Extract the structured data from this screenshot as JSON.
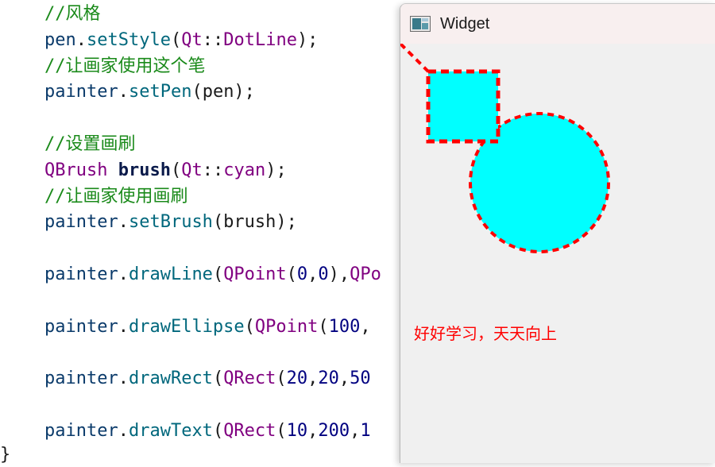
{
  "editor": {
    "lines": [
      {
        "segments": [
          {
            "t": "//风格",
            "c": "c-comment"
          }
        ]
      },
      {
        "segments": [
          {
            "t": "pen",
            "c": "c-obj"
          },
          {
            "t": ".",
            "c": "c-punct"
          },
          {
            "t": "setStyle",
            "c": "c-method"
          },
          {
            "t": "(",
            "c": "c-punct"
          },
          {
            "t": "Qt",
            "c": "c-type"
          },
          {
            "t": "::",
            "c": "c-punct"
          },
          {
            "t": "DotLine",
            "c": "c-type"
          },
          {
            "t": ");",
            "c": "c-punct"
          }
        ]
      },
      {
        "segments": [
          {
            "t": "//让画家使用这个笔",
            "c": "c-comment"
          }
        ]
      },
      {
        "segments": [
          {
            "t": "painter",
            "c": "c-obj"
          },
          {
            "t": ".",
            "c": "c-punct"
          },
          {
            "t": "setPen",
            "c": "c-method"
          },
          {
            "t": "(pen);",
            "c": "c-punct"
          }
        ]
      },
      {
        "segments": []
      },
      {
        "segments": [
          {
            "t": "//设置画刷",
            "c": "c-comment"
          }
        ]
      },
      {
        "segments": [
          {
            "t": "QBrush",
            "c": "c-type"
          },
          {
            "t": " ",
            "c": "c-punct"
          },
          {
            "t": "brush",
            "c": "c-bold"
          },
          {
            "t": "(",
            "c": "c-punct"
          },
          {
            "t": "Qt",
            "c": "c-type"
          },
          {
            "t": "::",
            "c": "c-punct"
          },
          {
            "t": "cyan",
            "c": "c-type"
          },
          {
            "t": ");",
            "c": "c-punct"
          }
        ]
      },
      {
        "segments": [
          {
            "t": "//让画家使用画刷",
            "c": "c-comment"
          }
        ]
      },
      {
        "segments": [
          {
            "t": "painter",
            "c": "c-obj"
          },
          {
            "t": ".",
            "c": "c-punct"
          },
          {
            "t": "setBrush",
            "c": "c-method"
          },
          {
            "t": "(brush);",
            "c": "c-punct"
          }
        ]
      },
      {
        "segments": []
      },
      {
        "segments": [
          {
            "t": "painter",
            "c": "c-obj"
          },
          {
            "t": ".",
            "c": "c-punct"
          },
          {
            "t": "drawLine",
            "c": "c-method"
          },
          {
            "t": "(",
            "c": "c-punct"
          },
          {
            "t": "QPoint",
            "c": "c-type"
          },
          {
            "t": "(",
            "c": "c-punct"
          },
          {
            "t": "0",
            "c": "c-num"
          },
          {
            "t": ",",
            "c": "c-punct"
          },
          {
            "t": "0",
            "c": "c-num"
          },
          {
            "t": "),",
            "c": "c-punct"
          },
          {
            "t": "QPo",
            "c": "c-type"
          }
        ]
      },
      {
        "segments": []
      },
      {
        "segments": [
          {
            "t": "painter",
            "c": "c-obj"
          },
          {
            "t": ".",
            "c": "c-punct"
          },
          {
            "t": "drawEllipse",
            "c": "c-method"
          },
          {
            "t": "(",
            "c": "c-punct"
          },
          {
            "t": "QPoint",
            "c": "c-type"
          },
          {
            "t": "(",
            "c": "c-punct"
          },
          {
            "t": "100",
            "c": "c-num"
          },
          {
            "t": ",",
            "c": "c-punct"
          }
        ]
      },
      {
        "segments": []
      },
      {
        "segments": [
          {
            "t": "painter",
            "c": "c-obj"
          },
          {
            "t": ".",
            "c": "c-punct"
          },
          {
            "t": "drawRect",
            "c": "c-method"
          },
          {
            "t": "(",
            "c": "c-punct"
          },
          {
            "t": "QRect",
            "c": "c-type"
          },
          {
            "t": "(",
            "c": "c-punct"
          },
          {
            "t": "20",
            "c": "c-num"
          },
          {
            "t": ",",
            "c": "c-punct"
          },
          {
            "t": "20",
            "c": "c-num"
          },
          {
            "t": ",",
            "c": "c-punct"
          },
          {
            "t": "50",
            "c": "c-num"
          }
        ]
      },
      {
        "segments": []
      },
      {
        "segments": [
          {
            "t": "painter",
            "c": "c-obj"
          },
          {
            "t": ".",
            "c": "c-punct"
          },
          {
            "t": "drawText",
            "c": "c-method"
          },
          {
            "t": "(",
            "c": "c-punct"
          },
          {
            "t": "QRect",
            "c": "c-type"
          },
          {
            "t": "(",
            "c": "c-punct"
          },
          {
            "t": "10",
            "c": "c-num"
          },
          {
            "t": ",",
            "c": "c-punct"
          },
          {
            "t": "200",
            "c": "c-num"
          },
          {
            "t": ",",
            "c": "c-punct"
          },
          {
            "t": "1",
            "c": "c-num"
          }
        ]
      }
    ],
    "closing_brace": "}"
  },
  "widget": {
    "title": "Widget",
    "text": "好好学习，天天向上",
    "colors": {
      "pen": "#ff0000",
      "brush": "#00ffff",
      "background": "#f0f0f0"
    },
    "pen_style": "DotLine"
  }
}
